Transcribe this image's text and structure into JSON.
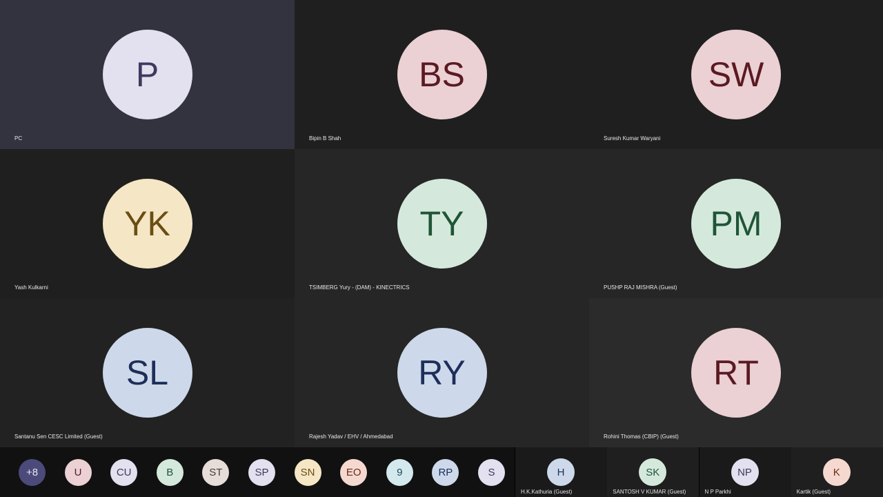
{
  "participants": [
    {
      "initials": "P",
      "name": "PC",
      "bg": "#33333f",
      "avatar_bg": "#e3e0ef",
      "avatar_fg": "#3f3a5c"
    },
    {
      "initials": "BS",
      "name": "Bipin B Shah",
      "bg": "#1f1f1f",
      "avatar_bg": "#ebd0d4",
      "avatar_fg": "#5a1a22"
    },
    {
      "initials": "SW",
      "name": "Suresh Kumar Waryani",
      "bg": "#1f1f1f",
      "avatar_bg": "#ebd0d4",
      "avatar_fg": "#5a1a22"
    },
    {
      "initials": "YK",
      "name": "Yash Kulkarni",
      "bg": "#1f1f1f",
      "avatar_bg": "#f5e6c5",
      "avatar_fg": "#6b4d14"
    },
    {
      "initials": "TY",
      "name": "TSIMBERG Yury - (DAM) - KINECTRICS",
      "bg": "#262626",
      "avatar_bg": "#d4e9dc",
      "avatar_fg": "#1f5536"
    },
    {
      "initials": "PM",
      "name": "PUSHP RAJ MISHRA (Guest)",
      "bg": "#262626",
      "avatar_bg": "#d4e9dc",
      "avatar_fg": "#1f5536"
    },
    {
      "initials": "SL",
      "name": "Santanu Sen CESC Limited (Guest)",
      "bg": "#222222",
      "avatar_bg": "#cdd9ea",
      "avatar_fg": "#1d2e5a"
    },
    {
      "initials": "RY",
      "name": "Rajesh Yadav / EHV / Ahmedabad",
      "bg": "#262626",
      "avatar_bg": "#cdd9ea",
      "avatar_fg": "#1d2e5a"
    },
    {
      "initials": "RT",
      "name": "Rohini Thomas (CBIP) (Guest)",
      "bg": "#2b2b2b",
      "avatar_bg": "#ebd0d4",
      "avatar_fg": "#5a1a22"
    }
  ],
  "overflow_avatars": [
    {
      "initials": "+8",
      "bg": "#4c4a7a",
      "fg": "#e8e8f5"
    },
    {
      "initials": "U",
      "bg": "#ebd0d4",
      "fg": "#5a1a22"
    },
    {
      "initials": "CU",
      "bg": "#e3e0ef",
      "fg": "#3f3a5c"
    },
    {
      "initials": "B",
      "bg": "#d4e9dc",
      "fg": "#1f5536"
    },
    {
      "initials": "ST",
      "bg": "#e6ddd8",
      "fg": "#4a3a33"
    },
    {
      "initials": "SP",
      "bg": "#e3e0ef",
      "fg": "#3f3a5c"
    },
    {
      "initials": "SN",
      "bg": "#f5e6c5",
      "fg": "#6b4d14"
    },
    {
      "initials": "EO",
      "bg": "#f5d9d0",
      "fg": "#6b2a18"
    },
    {
      "initials": "9",
      "bg": "#d4e9ee",
      "fg": "#1f4a55"
    },
    {
      "initials": "RP",
      "bg": "#cdd9ea",
      "fg": "#1d2e5a"
    },
    {
      "initials": "S",
      "bg": "#e3e0ef",
      "fg": "#3f3a5c"
    }
  ],
  "strip_participants": [
    {
      "initials": "H",
      "name": "H.K.Kathuria (Guest)",
      "bg": "#1a1a1a",
      "avatar_bg": "#cdd9ea",
      "avatar_fg": "#1d2e5a"
    },
    {
      "initials": "SK",
      "name": "SANTOSH V KUMAR (Guest)",
      "bg": "#1f1f1f",
      "avatar_bg": "#d4e9dc",
      "avatar_fg": "#1f5536"
    },
    {
      "initials": "NP",
      "name": "N P Parkhi",
      "bg": "#1a1a1a",
      "avatar_bg": "#e3e0ef",
      "avatar_fg": "#3f3a5c"
    },
    {
      "initials": "K",
      "name": "Kartik (Guest)",
      "bg": "#1f1f1f",
      "avatar_bg": "#f5d9d0",
      "avatar_fg": "#6b2a18"
    }
  ]
}
